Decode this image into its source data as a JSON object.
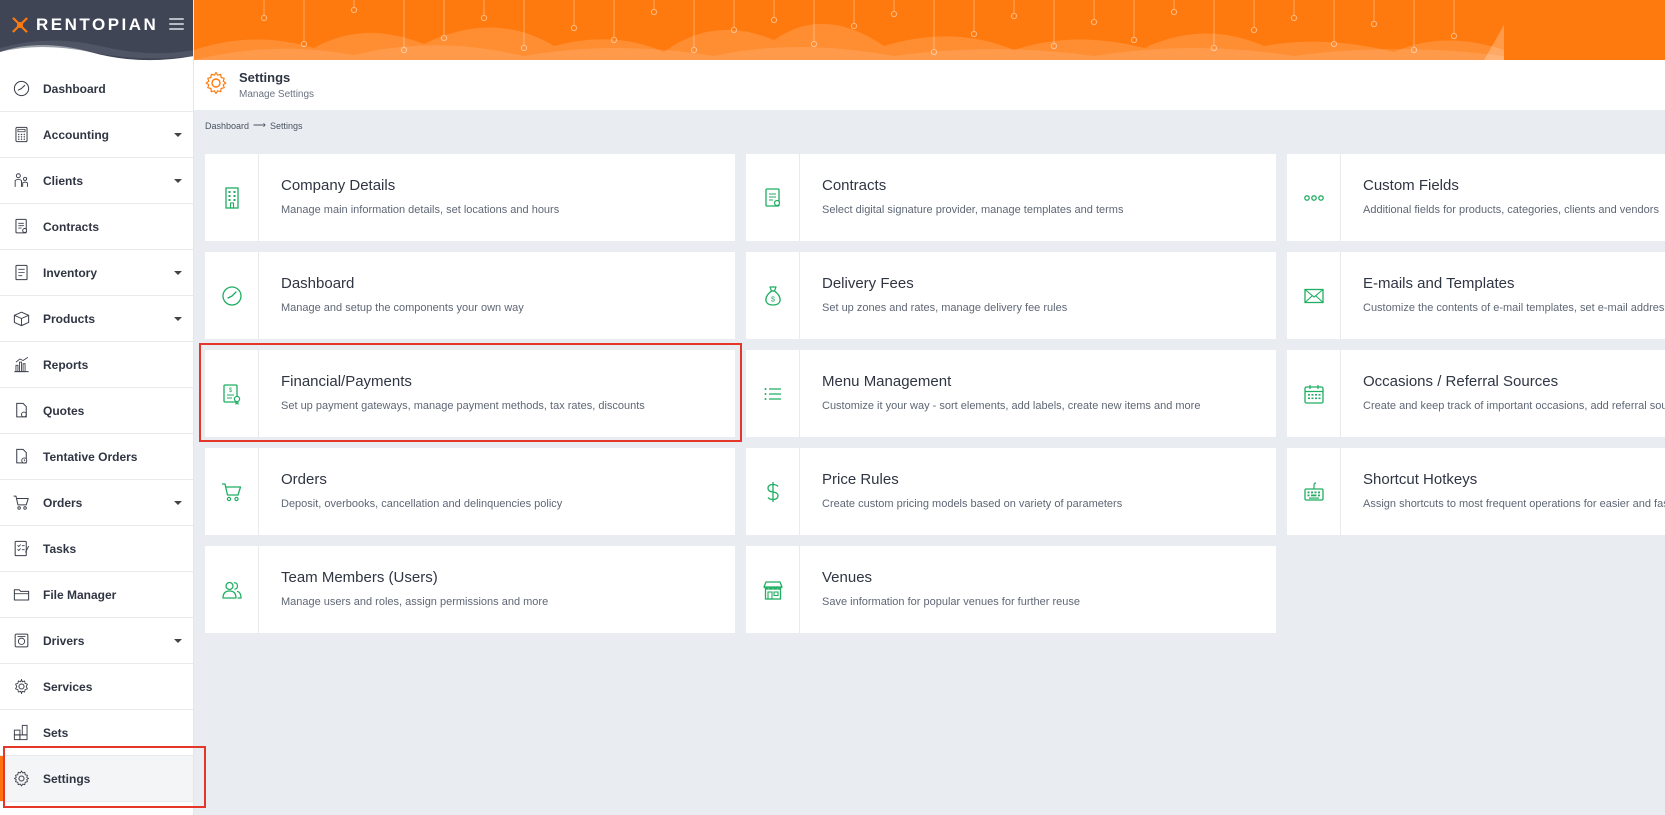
{
  "app": {
    "brand": "RENTOPIAN",
    "accent_color": "#ff7a0e",
    "icon_color": "#1fae62"
  },
  "sidebar": {
    "items": [
      {
        "label": "Dashboard",
        "icon": "dashboard-icon",
        "caret": false
      },
      {
        "label": "Accounting",
        "icon": "calculator-icon",
        "caret": true
      },
      {
        "label": "Clients",
        "icon": "clients-icon",
        "caret": true
      },
      {
        "label": "Contracts",
        "icon": "contract-icon",
        "caret": false
      },
      {
        "label": "Inventory",
        "icon": "inventory-icon",
        "caret": true
      },
      {
        "label": "Products",
        "icon": "box-icon",
        "caret": true
      },
      {
        "label": "Reports",
        "icon": "bar-chart-icon",
        "caret": false
      },
      {
        "label": "Quotes",
        "icon": "quote-icon",
        "caret": false
      },
      {
        "label": "Tentative Orders",
        "icon": "tentative-icon",
        "caret": false
      },
      {
        "label": "Orders",
        "icon": "cart-icon",
        "caret": true
      },
      {
        "label": "Tasks",
        "icon": "tasks-icon",
        "caret": false
      },
      {
        "label": "File Manager",
        "icon": "folder-icon",
        "caret": false
      },
      {
        "label": "Drivers",
        "icon": "driver-icon",
        "caret": true
      },
      {
        "label": "Services",
        "icon": "services-icon",
        "caret": false
      },
      {
        "label": "Sets",
        "icon": "sets-icon",
        "caret": false
      },
      {
        "label": "Settings",
        "icon": "gear-icon",
        "caret": false,
        "active": true
      }
    ]
  },
  "header": {
    "title": "Settings",
    "subtitle": "Manage Settings"
  },
  "breadcrumb": {
    "root": "Dashboard",
    "arrow": "⟶",
    "current": "Settings"
  },
  "cards": [
    {
      "title": "Company Details",
      "desc": "Manage main information details, set locations and hours",
      "icon": "building-icon"
    },
    {
      "title": "Contracts",
      "desc": "Select digital signature provider, manage templates and terms",
      "icon": "contract-icon"
    },
    {
      "title": "Custom Fields",
      "desc": "Additional fields for products, categories, clients and vendors",
      "icon": "dots-icon"
    },
    {
      "title": "Dashboard",
      "desc": "Manage and setup the components your own way",
      "icon": "dashboard-icon"
    },
    {
      "title": "Delivery Fees",
      "desc": "Set up zones and rates, manage delivery fee rules",
      "icon": "money-bag-icon"
    },
    {
      "title": "E-mails and Templates",
      "desc": "Customize the contents of e-mail templates, set e-mail address",
      "icon": "envelope-icon"
    },
    {
      "title": "Financial/Payments",
      "desc": "Set up payment gateways, manage payment methods, tax rates, discounts",
      "icon": "invoice-icon"
    },
    {
      "title": "Menu Management",
      "desc": "Customize it your way - sort elements, add labels, create new items and more",
      "icon": "list-icon"
    },
    {
      "title": "Occasions / Referral Sources",
      "desc": "Create and keep track of important occasions, add referral sources",
      "icon": "calendar-icon"
    },
    {
      "title": "Orders",
      "desc": "Deposit, overbooks, cancellation and delinquencies policy",
      "icon": "cart-icon"
    },
    {
      "title": "Price Rules",
      "desc": "Create custom pricing models based on variety of parameters",
      "icon": "dollar-icon"
    },
    {
      "title": "Shortcut Hotkeys",
      "desc": "Assign shortcuts to most frequent operations for easier and faster work",
      "icon": "keyboard-icon"
    },
    {
      "title": "Team Members (Users)",
      "desc": "Manage users and roles, assign permissions and more",
      "icon": "users-icon"
    },
    {
      "title": "Venues",
      "desc": "Save information for popular venues for further reuse",
      "icon": "venue-icon"
    }
  ]
}
